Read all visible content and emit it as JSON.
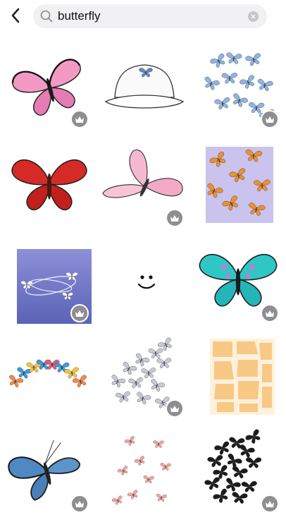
{
  "search": {
    "value": "butterfly",
    "placeholder": "Search"
  },
  "icons": {
    "back": "chevron-left-icon",
    "search": "search-icon",
    "clear": "clear-icon",
    "premium": "crown-icon"
  },
  "colors": {
    "search_bg": "#f1f1f3",
    "premium_badge": "#8e8e90"
  },
  "stickers": [
    {
      "name": "pink-monarch-butterfly",
      "premium": true
    },
    {
      "name": "white-bucket-hat-with-butterfly",
      "premium": false
    },
    {
      "name": "blue-butterfly-swarm",
      "premium": true
    },
    {
      "name": "red-butterfly",
      "premium": false
    },
    {
      "name": "pink-flying-butterfly",
      "premium": true
    },
    {
      "name": "orange-butterflies-lavender-pattern",
      "premium": false
    },
    {
      "name": "purple-gradient-butterfly-orbit",
      "premium": true
    },
    {
      "name": "smiley-face",
      "premium": false
    },
    {
      "name": "teal-pink-butterfly",
      "premium": true
    },
    {
      "name": "colorful-butterfly-crown",
      "premium": false
    },
    {
      "name": "grey-butterfly-swarm",
      "premium": true
    },
    {
      "name": "peach-giraffe-pattern",
      "premium": false
    },
    {
      "name": "blue-swallowtail-butterfly",
      "premium": true
    },
    {
      "name": "pink-butterfly-scatter",
      "premium": false
    },
    {
      "name": "black-butterfly-swarm",
      "premium": true
    }
  ]
}
